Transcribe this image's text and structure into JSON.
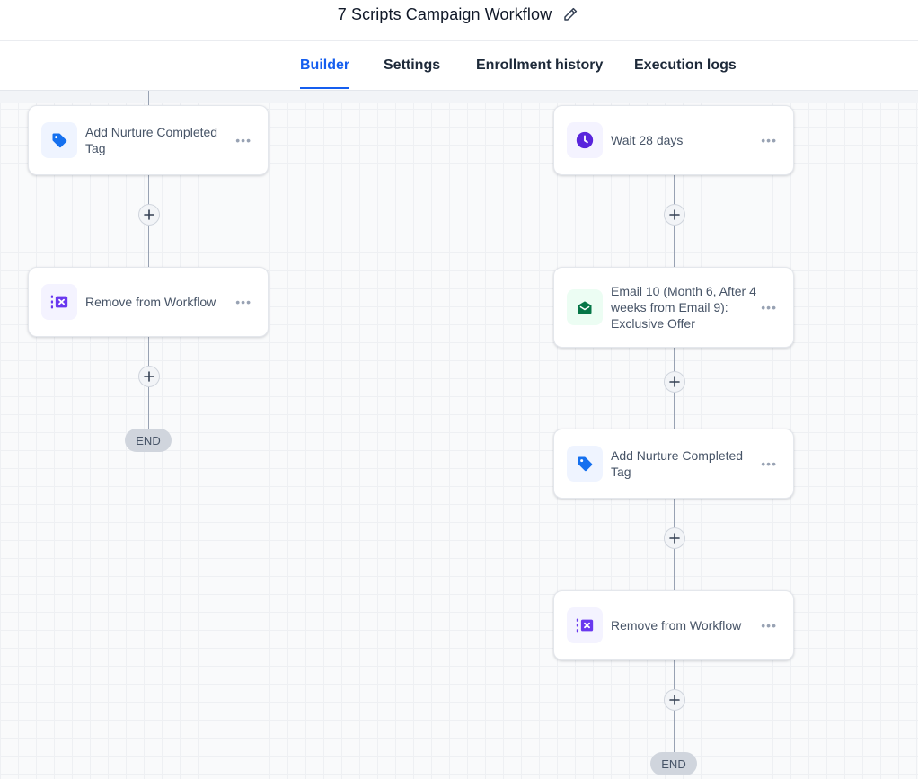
{
  "workflow": {
    "title": "7 Scripts Campaign Workflow"
  },
  "tabs": [
    {
      "label": "Builder",
      "active": true
    },
    {
      "label": "Settings",
      "active": false
    },
    {
      "label": "Enrollment history",
      "active": false
    },
    {
      "label": "Execution logs",
      "active": false
    }
  ],
  "left_branch": {
    "nodes": [
      {
        "label": "Add Nurture Completed Tag",
        "icon": "tag-icon"
      },
      {
        "label": "Remove from Workflow",
        "icon": "remove-from-workflow-icon"
      }
    ],
    "end_label": "END"
  },
  "right_branch": {
    "nodes": [
      {
        "label": "Wait 28 days",
        "icon": "clock-icon"
      },
      {
        "label": "Email 10 (Month 6, After 4 weeks from Email 9): Exclusive Offer",
        "icon": "email-icon"
      },
      {
        "label": "Add Nurture Completed Tag",
        "icon": "tag-icon"
      },
      {
        "label": "Remove from Workflow",
        "icon": "remove-from-workflow-icon"
      }
    ],
    "end_label": "END"
  },
  "node_menu_label": "•••",
  "colors": {
    "accent": "#155eef",
    "tag": "#1570ef",
    "wait": "#5925dc",
    "email": "#067647",
    "remove": "#6938ef"
  }
}
